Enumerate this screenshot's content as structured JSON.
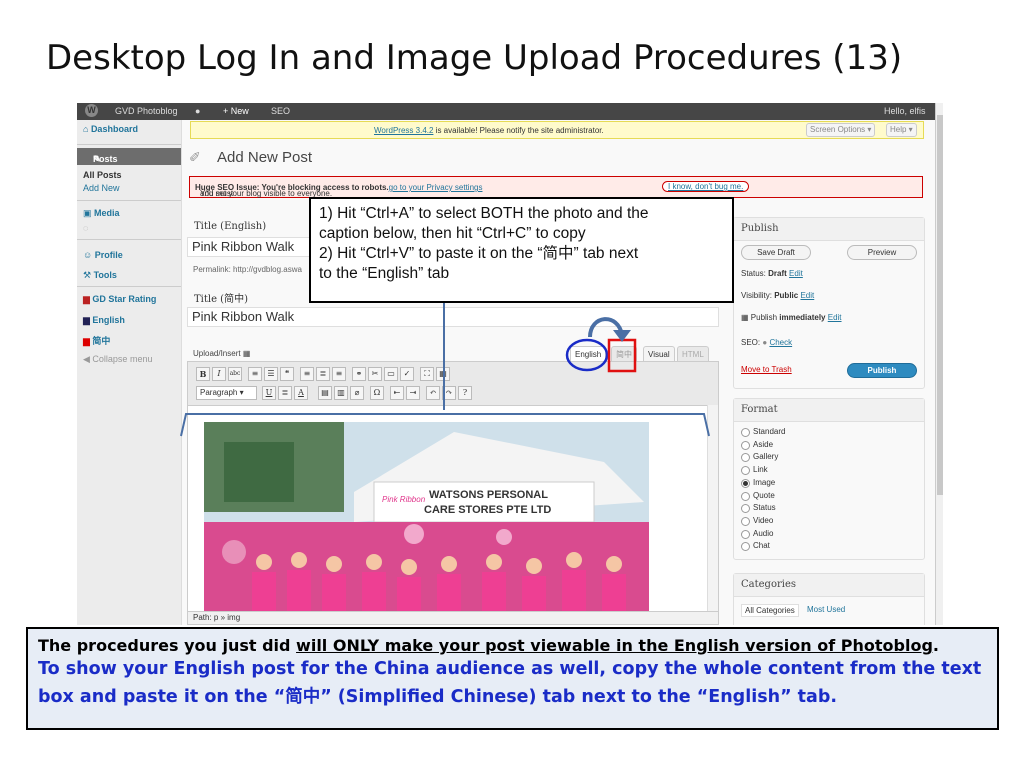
{
  "slide": {
    "title": "Desktop Log In and Image Upload Procedures (13)"
  },
  "admin_bar": {
    "site_name": "GVD Photoblog",
    "new_label": "+ New",
    "seo_label": "SEO",
    "greeting": "Hello, elfis"
  },
  "sidebar": {
    "dashboard": "Dashboard",
    "posts": "Posts",
    "all_posts": "All Posts",
    "add_new": "Add New",
    "media": "Media",
    "profile": "Profile",
    "tools": "Tools",
    "gd_star": "GD Star Rating",
    "english": "English",
    "chinese": "简中",
    "collapse": "Collapse menu"
  },
  "notice": {
    "link": "WordPress 3.4.2",
    "text": " is available! Please notify the site administrator.",
    "screen_options": "Screen Options ▾",
    "help": "Help ▾"
  },
  "page": {
    "heading": "Add New Post"
  },
  "seo_warning": {
    "bold": "Huge SEO Issue: You're blocking access to robots.",
    "text1": " You must ",
    "link": "go to your Privacy settings",
    "text2": " and set your blog visible to everyone.",
    "dismiss": "I know, don't bug me."
  },
  "editor": {
    "title_en_label": "Title (English)",
    "title_en_value": "Pink Ribbon Walk",
    "permalink": "Permalink: http://gvdblog.aswa",
    "title_cn_label": "Title (简中)",
    "title_cn_value": "Pink Ribbon Walk",
    "upload_insert": "Upload/Insert",
    "tab_english": "English",
    "tab_chinese": "简中",
    "tab_visual": "Visual",
    "tab_html": "HTML",
    "format_select": "Paragraph",
    "path": "Path: p » img",
    "photo_sign": "WATSONS PERSONAL CARE STORES PTE LTD",
    "photo_logo": "Pink Ribbon Walk 2011"
  },
  "publish": {
    "title": "Publish",
    "save_draft": "Save Draft",
    "preview": "Preview",
    "status_label": "Status: ",
    "status_value": "Draft",
    "edit": "Edit",
    "visibility_label": "Visibility: ",
    "visibility_value": "Public",
    "publish_label": "Publish ",
    "publish_value": "immediately",
    "seo_label": "SEO:",
    "check": "Check",
    "trash": "Move to Trash",
    "publish_button": "Publish"
  },
  "format_box": {
    "title": "Format",
    "options": [
      "Standard",
      "Aside",
      "Gallery",
      "Link",
      "Image",
      "Quote",
      "Status",
      "Video",
      "Audio",
      "Chat"
    ],
    "selected": "Image"
  },
  "categories": {
    "title": "Categories",
    "tab_all": "All Categories",
    "tab_used": "Most Used"
  },
  "callout": {
    "line1": "1) Hit “Ctrl+A” to select BOTH the photo and the",
    "line2": "caption below, then hit “Ctrl+C” to copy",
    "line3": "2) Hit “Ctrl+V” to paste it on the “简中” tab next",
    "line4": "to the “English” tab"
  },
  "bottom_note": {
    "l1a": "The procedures you just did ",
    "l1b": "will ONLY make your post viewable in the English version of Photoblog",
    "l1c": ".",
    "l2": "To show your English post for the China audience as well, copy the whole content from the text box and paste it on the “简中” (Simplified Chinese) tab next to the “English” tab."
  },
  "colors": {
    "admin_bar": "#464646",
    "link": "#21759b",
    "annotation_blue": "#1a2cc7",
    "annotation_red": "#e01010",
    "arrow_blue": "#4a6fa5"
  }
}
